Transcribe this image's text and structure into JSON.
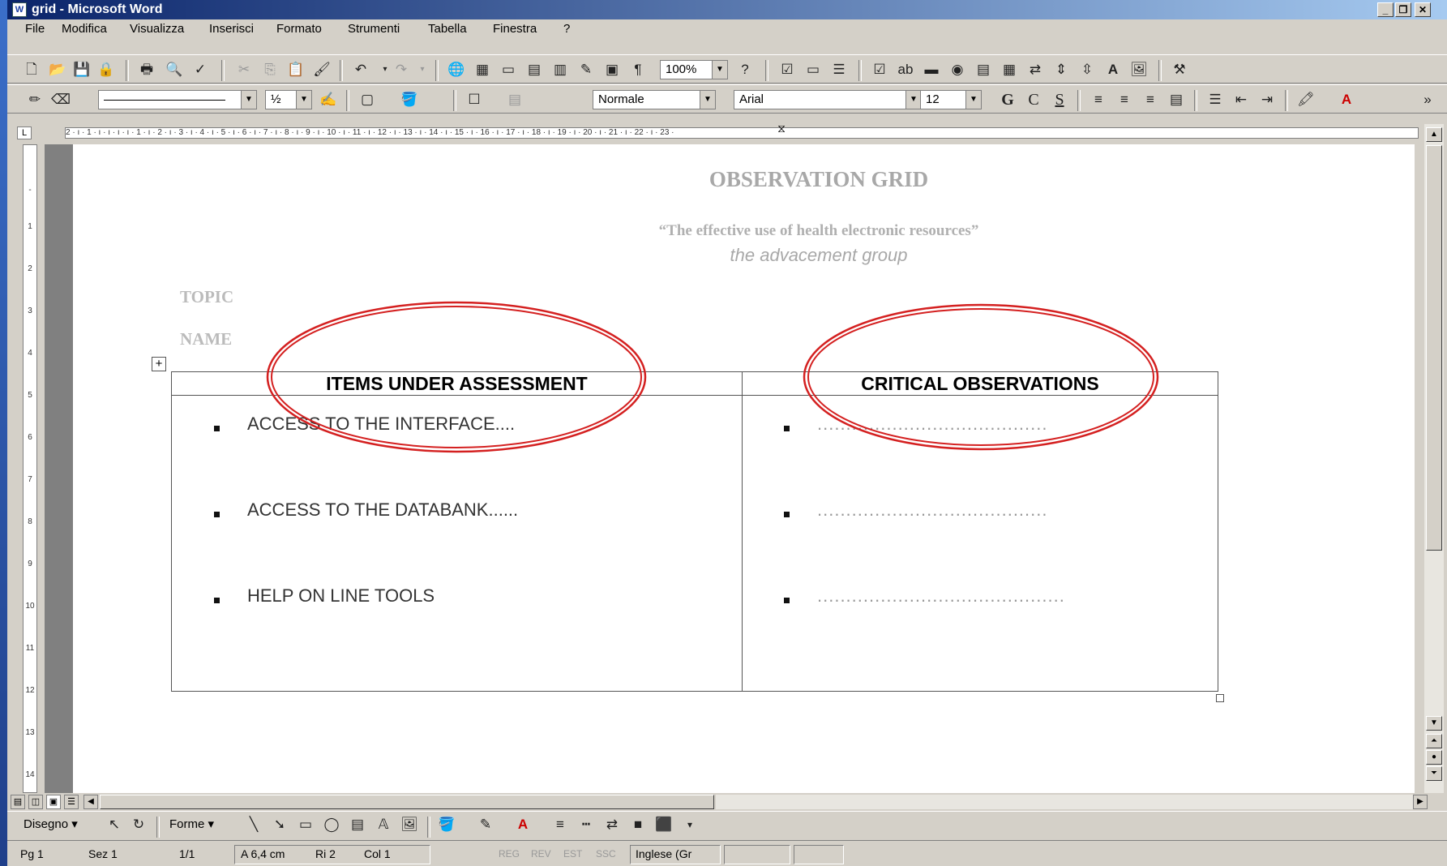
{
  "window": {
    "title": "grid - Microsoft Word",
    "app_icon": "word-document-icon"
  },
  "menubar": [
    "File",
    "Modifica",
    "Visualizza",
    "Inserisci",
    "Formato",
    "Strumenti",
    "Tabella",
    "Finestra",
    "?"
  ],
  "toolbar": {
    "zoom": "100%"
  },
  "formatting": {
    "line_weight": "½",
    "style": "Normale",
    "font": "Arial",
    "size": "12",
    "bold": "G",
    "italic": "C",
    "underline": "S"
  },
  "ruler": {
    "ticks": "2 · ı · 1 · ı · ı · ı · ı · 1 · ı · 2 · ı · 3 · ı · 4 · ı · 5 · ı · 6 · ı · 7 · ı · 8 · ı · 9 · ı · 10 · ı · 11 · ı · 12 · ı · 13 · ı · 14 · ı · 15 · ı · 16 · ı · 17 · ı · 18 · ı · 19 · ı · 20 · ı · 21 · ı · 22 · ı · 23 ·",
    "vticks": [
      "-",
      "1",
      "2",
      "3",
      "4",
      "5",
      "6",
      "7",
      "8",
      "9",
      "10",
      "11",
      "12",
      "13",
      "14"
    ]
  },
  "document": {
    "heading": "OBSERVATION GRID",
    "subtitle": "“The effective use of health electronic resources”",
    "group": "the advacement group",
    "topic_label": "TOPIC",
    "name_label": "NAME",
    "table": {
      "col1_header": "ITEMS UNDER ASSESSMENT",
      "col2_header": "CRITICAL OBSERVATIONS",
      "items": [
        "ACCESS TO THE INTERFACE....",
        "ACCESS TO THE DATABANK......",
        "HELP ON LINE TOOLS"
      ],
      "observations": [
        "........................................",
        "........................................",
        "..........................................."
      ]
    }
  },
  "drawbar": {
    "draw_label": "Disegno",
    "shapes_label": "Forme"
  },
  "statusbar": {
    "page": "Pg 1",
    "section": "Sez 1",
    "pages": "1/1",
    "at": "A 6,4 cm",
    "line": "Ri 2",
    "col": "Col 1",
    "rec": "REG",
    "rev": "REV",
    "ext": "EST",
    "ovr": "SSC",
    "language": "Inglese (Gr"
  },
  "colors": {
    "titlebar": "#0a246a",
    "annotation": "#d42020",
    "chrome": "#d4d0c8"
  }
}
